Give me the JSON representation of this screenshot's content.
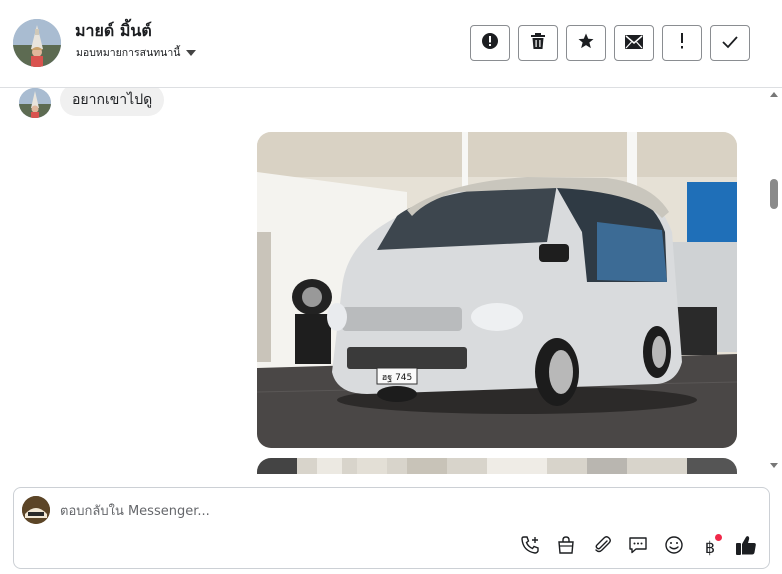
{
  "header": {
    "contact_name": "มายด์ มิ้นต์",
    "assign_label": "มอบหมายการสนทนานี้",
    "actions": [
      {
        "name": "spam-button",
        "icon": "alert-circle-icon"
      },
      {
        "name": "delete-button",
        "icon": "trash-icon"
      },
      {
        "name": "star-button",
        "icon": "star-icon"
      },
      {
        "name": "mark-unread-button",
        "icon": "envelope-icon"
      },
      {
        "name": "flag-button",
        "icon": "exclamation-icon"
      },
      {
        "name": "mark-done-button",
        "icon": "check-icon"
      }
    ]
  },
  "conversation": {
    "messages": [
      {
        "type": "text",
        "text": "อยากเขาไปดู",
        "from": "contact"
      },
      {
        "type": "image",
        "subject": "white van photo",
        "from": "page",
        "plate_text": "ฮฐ 745"
      }
    ]
  },
  "composer": {
    "placeholder": "ตอบกลับใน Messenger...",
    "tools": [
      "call-add-icon",
      "shopping-bag-icon",
      "paperclip-icon",
      "saved-reply-icon",
      "emoji-icon",
      "baht-icon",
      "thumbs-up-icon"
    ],
    "baht_symbol": "฿"
  },
  "colors": {
    "border": "#dddfe2",
    "bubble_bg": "#f0f0f0",
    "notification_dot": "#f02849"
  }
}
